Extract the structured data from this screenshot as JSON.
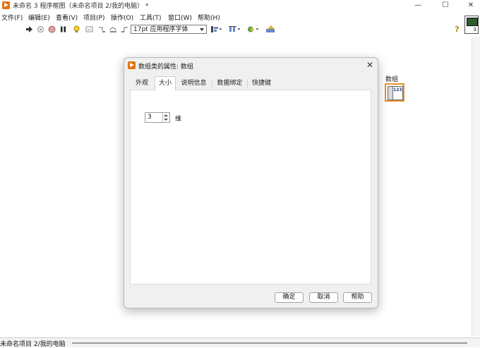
{
  "window": {
    "title": "未命名 3 程序框图（未命名项目 2/我的电脑）  *",
    "minimize_glyph": "—",
    "maximize_glyph": "☐",
    "close_glyph": "✕"
  },
  "menu": [
    "文件(F)",
    "编辑(E)",
    "查看(V)",
    "项目(P)",
    "操作(O)",
    "工具(T)",
    "窗口(W)",
    "帮助(H)"
  ],
  "toolbar": {
    "font_select_value": "17pt 应用程序字体",
    "help_glyph": "?",
    "vi_icon_number": "3",
    "icons": [
      "run-arrow-icon",
      "highlight-execution-icon",
      "abort-icon",
      "pause-icon",
      "lightbulb-icon",
      "retain-wire-values-icon",
      "step-into-icon",
      "step-over-icon",
      "step-out-icon",
      "align-icon",
      "distribute-icon",
      "reorder-icon",
      "cleanup-diagram-icon"
    ]
  },
  "diagram": {
    "terminal_label": "数组"
  },
  "dialog": {
    "title": "数组类的属性: 数组",
    "close_glyph": "✕",
    "tabs": [
      "外观",
      "大小",
      "说明信息",
      "数据绑定",
      "快捷键"
    ],
    "active_tab_index": 1,
    "dimensions_value": "3",
    "dimensions_label": "维",
    "buttons": {
      "ok": "确定",
      "cancel": "取消",
      "help": "帮助"
    }
  },
  "status": {
    "project_path": "未命名项目 2/我的电脑"
  },
  "colors": {
    "accent_orange": "#e2750f",
    "terminal_border": "#e8912a"
  }
}
